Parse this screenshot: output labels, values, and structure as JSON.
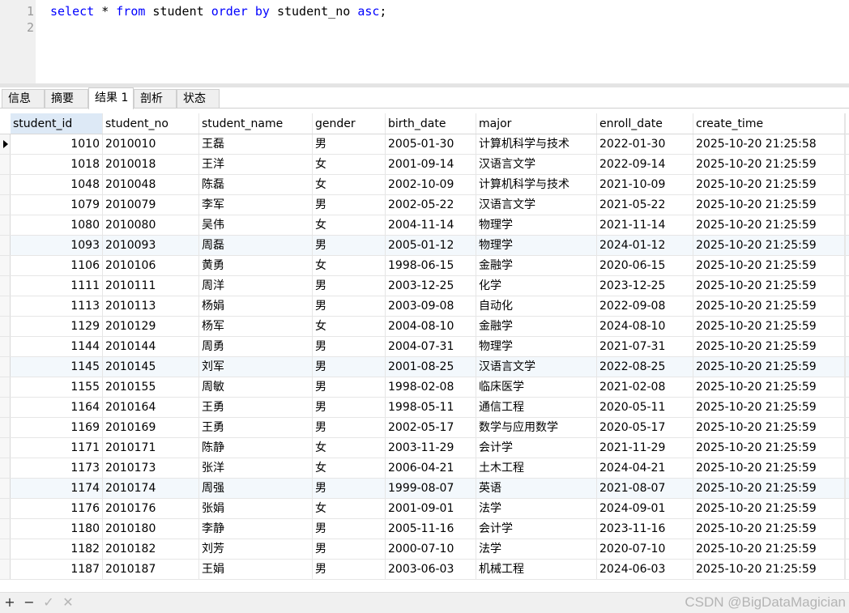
{
  "editor": {
    "line_numbers": [
      "1",
      "2"
    ],
    "query_tokens": [
      {
        "text": "select",
        "kw": true
      },
      {
        "text": " * ",
        "kw": false
      },
      {
        "text": "from",
        "kw": true
      },
      {
        "text": " student ",
        "kw": false
      },
      {
        "text": "order",
        "kw": true
      },
      {
        "text": " ",
        "kw": false
      },
      {
        "text": "by",
        "kw": true
      },
      {
        "text": " student_no ",
        "kw": false
      },
      {
        "text": "asc",
        "kw": true
      },
      {
        "text": ";",
        "kw": false
      }
    ]
  },
  "tabs": [
    {
      "label": "信息",
      "active": false
    },
    {
      "label": "摘要",
      "active": false
    },
    {
      "label": "结果 1",
      "active": true
    },
    {
      "label": "剖析",
      "active": false
    },
    {
      "label": "状态",
      "active": false
    }
  ],
  "grid": {
    "columns": [
      "student_id",
      "student_no",
      "student_name",
      "gender",
      "birth_date",
      "major",
      "enroll_date",
      "create_time"
    ],
    "sorted_column": "student_id",
    "rows": [
      [
        "1010",
        "2010010",
        "王磊",
        "男",
        "2005-01-30",
        "计算机科学与技术",
        "2022-01-30",
        "2025-10-20 21:25:58"
      ],
      [
        "1018",
        "2010018",
        "王洋",
        "女",
        "2001-09-14",
        "汉语言文学",
        "2022-09-14",
        "2025-10-20 21:25:59"
      ],
      [
        "1048",
        "2010048",
        "陈磊",
        "女",
        "2002-10-09",
        "计算机科学与技术",
        "2021-10-09",
        "2025-10-20 21:25:59"
      ],
      [
        "1079",
        "2010079",
        "李军",
        "男",
        "2002-05-22",
        "汉语言文学",
        "2021-05-22",
        "2025-10-20 21:25:59"
      ],
      [
        "1080",
        "2010080",
        "吴伟",
        "女",
        "2004-11-14",
        "物理学",
        "2021-11-14",
        "2025-10-20 21:25:59"
      ],
      [
        "1093",
        "2010093",
        "周磊",
        "男",
        "2005-01-12",
        "物理学",
        "2024-01-12",
        "2025-10-20 21:25:59"
      ],
      [
        "1106",
        "2010106",
        "黄勇",
        "女",
        "1998-06-15",
        "金融学",
        "2020-06-15",
        "2025-10-20 21:25:59"
      ],
      [
        "1111",
        "2010111",
        "周洋",
        "男",
        "2003-12-25",
        "化学",
        "2023-12-25",
        "2025-10-20 21:25:59"
      ],
      [
        "1113",
        "2010113",
        "杨娟",
        "男",
        "2003-09-08",
        "自动化",
        "2022-09-08",
        "2025-10-20 21:25:59"
      ],
      [
        "1129",
        "2010129",
        "杨军",
        "女",
        "2004-08-10",
        "金融学",
        "2024-08-10",
        "2025-10-20 21:25:59"
      ],
      [
        "1144",
        "2010144",
        "周勇",
        "男",
        "2004-07-31",
        "物理学",
        "2021-07-31",
        "2025-10-20 21:25:59"
      ],
      [
        "1145",
        "2010145",
        "刘军",
        "男",
        "2001-08-25",
        "汉语言文学",
        "2022-08-25",
        "2025-10-20 21:25:59"
      ],
      [
        "1155",
        "2010155",
        "周敏",
        "男",
        "1998-02-08",
        "临床医学",
        "2021-02-08",
        "2025-10-20 21:25:59"
      ],
      [
        "1164",
        "2010164",
        "王勇",
        "男",
        "1998-05-11",
        "通信工程",
        "2020-05-11",
        "2025-10-20 21:25:59"
      ],
      [
        "1169",
        "2010169",
        "王勇",
        "男",
        "2002-05-17",
        "数学与应用数学",
        "2020-05-17",
        "2025-10-20 21:25:59"
      ],
      [
        "1171",
        "2010171",
        "陈静",
        "女",
        "2003-11-29",
        "会计学",
        "2021-11-29",
        "2025-10-20 21:25:59"
      ],
      [
        "1173",
        "2010173",
        "张洋",
        "女",
        "2006-04-21",
        "土木工程",
        "2024-04-21",
        "2025-10-20 21:25:59"
      ],
      [
        "1174",
        "2010174",
        "周强",
        "男",
        "1999-08-07",
        "英语",
        "2021-08-07",
        "2025-10-20 21:25:59"
      ],
      [
        "1176",
        "2010176",
        "张娟",
        "女",
        "2001-09-01",
        "法学",
        "2024-09-01",
        "2025-10-20 21:25:59"
      ],
      [
        "1180",
        "2010180",
        "李静",
        "男",
        "2005-11-16",
        "会计学",
        "2023-11-16",
        "2025-10-20 21:25:59"
      ],
      [
        "1182",
        "2010182",
        "刘芳",
        "男",
        "2000-07-10",
        "法学",
        "2020-07-10",
        "2025-10-20 21:25:59"
      ],
      [
        "1187",
        "2010187",
        "王娟",
        "男",
        "2003-06-03",
        "机械工程",
        "2024-06-03",
        "2025-10-20 21:25:59"
      ]
    ],
    "highlighted_rows": [
      5,
      11,
      17
    ],
    "current_row": 0
  },
  "toolbar": {
    "add_symbol": "+",
    "remove_symbol": "−",
    "apply_symbol": "✓",
    "discard_symbol": "✕"
  },
  "watermark": "CSDN @BigDataMagician",
  "colors": {
    "keyword": "#0000ff",
    "sorted_header": "#dde9f6",
    "highlight_row": "#f3f8fc"
  }
}
